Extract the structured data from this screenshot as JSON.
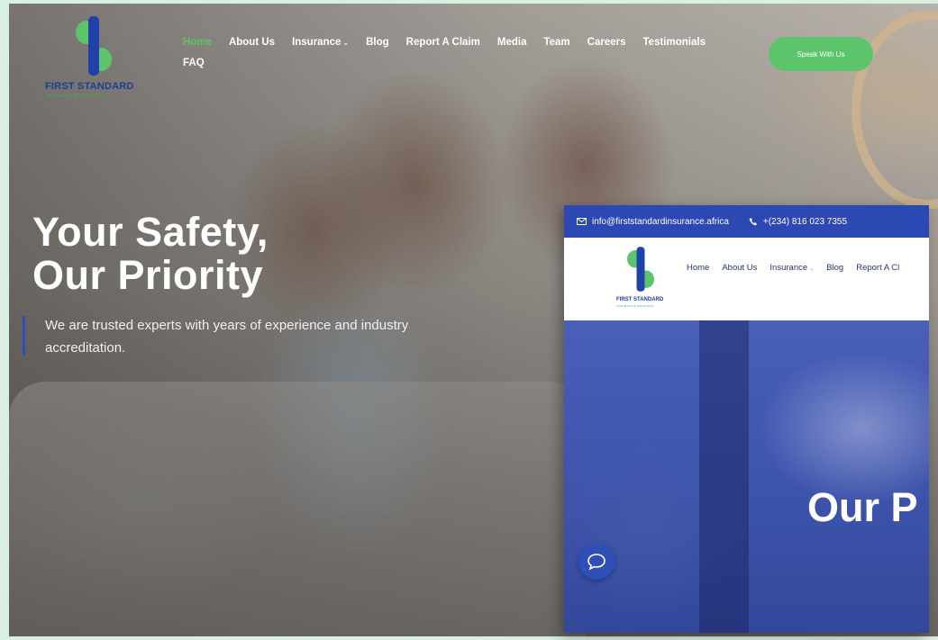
{
  "brand": {
    "name": "FIRST STANDARD",
    "tagline": "INSURANCE BROKERS",
    "colors": {
      "primary_blue": "#2f4fb8",
      "accent_green": "#5cc56c"
    }
  },
  "nav": {
    "items": [
      {
        "label": "Home",
        "active": true
      },
      {
        "label": "About Us"
      },
      {
        "label": "Insurance",
        "has_dropdown": true
      },
      {
        "label": "Blog"
      },
      {
        "label": "Report A Claim"
      },
      {
        "label": "Media"
      },
      {
        "label": "Team"
      },
      {
        "label": "Careers"
      },
      {
        "label": "Testimonials"
      },
      {
        "label": "FAQ"
      }
    ],
    "cta_label": "Speak With Us"
  },
  "hero": {
    "title_line1": "Your Safety,",
    "title_line2": "Our Priority",
    "description": "We are trusted experts with years of experience and industry accreditation."
  },
  "chat": {
    "icon": "chat-bubble-icon"
  },
  "inset": {
    "topbar": {
      "email": "info@firststandardinsurance.africa",
      "phone": "+(234) 816 023 7355"
    },
    "nav": {
      "items": [
        {
          "label": "Home"
        },
        {
          "label": "About Us"
        },
        {
          "label": "Insurance",
          "has_dropdown": true
        },
        {
          "label": "Blog"
        },
        {
          "label": "Report A Cl"
        }
      ]
    },
    "hero_title": "Our P"
  }
}
